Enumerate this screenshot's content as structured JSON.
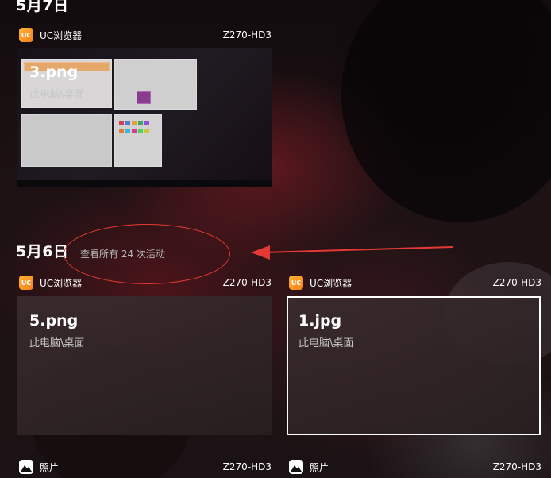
{
  "groups": [
    {
      "date": "5月7日",
      "cards": [
        {
          "app": "UC浏览器",
          "device": "Z270-HD3",
          "title": "3.png",
          "path": "此电脑\\桌面",
          "app_icon": "uc-browser-icon",
          "has_thumbnail": true
        }
      ]
    },
    {
      "date": "5月6日",
      "see_all": "查看所有 24 次活动",
      "cards": [
        {
          "app": "UC浏览器",
          "device": "Z270-HD3",
          "title": "5.png",
          "path": "此电脑\\桌面",
          "app_icon": "uc-browser-icon"
        },
        {
          "app": "UC浏览器",
          "device": "Z270-HD3",
          "title": "1.jpg",
          "path": "此电脑\\桌面",
          "app_icon": "uc-browser-icon",
          "selected": true
        },
        {
          "app": "照片",
          "device": "Z270-HD3",
          "app_icon": "photos-icon"
        },
        {
          "app": "照片",
          "device": "Z270-HD3",
          "app_icon": "photos-icon"
        }
      ]
    }
  ],
  "annotation": {
    "color": "#e53935"
  }
}
